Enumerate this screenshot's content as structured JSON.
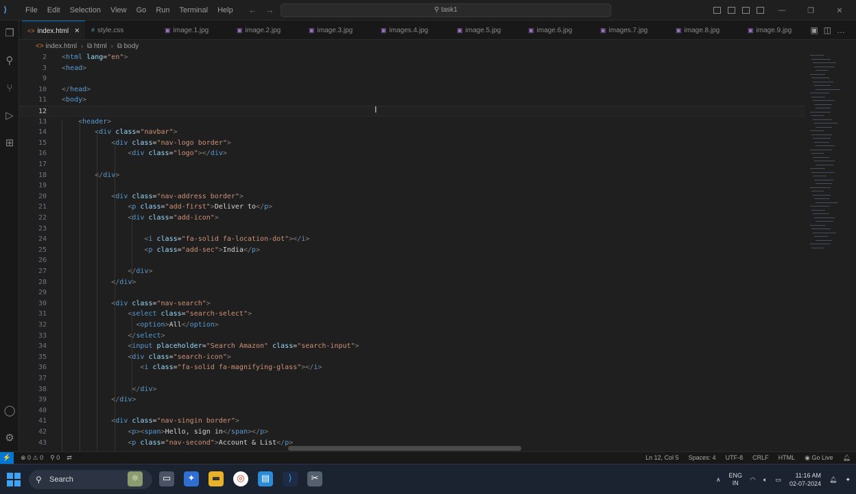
{
  "titlebar": {
    "menu": [
      "File",
      "Edit",
      "Selection",
      "View",
      "Go",
      "Run",
      "Terminal",
      "Help"
    ],
    "search": "task1"
  },
  "tabs": [
    {
      "label": "index.html",
      "icon": "html-file-icon",
      "active": true
    },
    {
      "label": "style.css",
      "icon": "css-file-icon",
      "active": false
    },
    {
      "label": "image.1.jpg",
      "icon": "image-file-icon",
      "active": false
    },
    {
      "label": "image.2.jpg",
      "icon": "image-file-icon",
      "active": false
    },
    {
      "label": "image.3.jpg",
      "icon": "image-file-icon",
      "active": false
    },
    {
      "label": "images.4.jpg",
      "icon": "image-file-icon",
      "active": false
    },
    {
      "label": "image.5.jpg",
      "icon": "image-file-icon",
      "active": false
    },
    {
      "label": "image.6.jpg",
      "icon": "image-file-icon",
      "active": false
    },
    {
      "label": "images.7.jpg",
      "icon": "image-file-icon",
      "active": false
    },
    {
      "label": "image.8.jpg",
      "icon": "image-file-icon",
      "active": false
    },
    {
      "label": "image.9.jpg",
      "icon": "image-file-icon",
      "active": false
    }
  ],
  "breadcrumb": [
    "index.html",
    "html",
    "body"
  ],
  "editor": {
    "current_line": 12,
    "lines": [
      {
        "n": "2",
        "code": "<html lang=\"en\">"
      },
      {
        "n": "3",
        "code": "<head>"
      },
      {
        "n": "9",
        "code": ""
      },
      {
        "n": "10",
        "code": "</head>"
      },
      {
        "n": "11",
        "code": "<body>"
      },
      {
        "n": "12",
        "code": ""
      },
      {
        "n": "13",
        "code": "    <header>"
      },
      {
        "n": "14",
        "code": "        <div class=\"navbar\">"
      },
      {
        "n": "15",
        "code": "            <div class=\"nav-logo border\">"
      },
      {
        "n": "16",
        "code": "                <div class=\"logo\"></div>"
      },
      {
        "n": "17",
        "code": ""
      },
      {
        "n": "18",
        "code": "        </div>"
      },
      {
        "n": "19",
        "code": ""
      },
      {
        "n": "20",
        "code": "            <div class=\"nav-address border\">"
      },
      {
        "n": "21",
        "code": "                <p class=\"add-first\">Deliver to</p>"
      },
      {
        "n": "22",
        "code": "                <div class=\"add-icon\">"
      },
      {
        "n": "23",
        "code": ""
      },
      {
        "n": "24",
        "code": "                    <i class=\"fa-solid fa-location-dot\"></i>"
      },
      {
        "n": "25",
        "code": "                    <p class=\"add-sec\">India</p>"
      },
      {
        "n": "26",
        "code": ""
      },
      {
        "n": "27",
        "code": "                </div>"
      },
      {
        "n": "28",
        "code": "            </div>"
      },
      {
        "n": "29",
        "code": ""
      },
      {
        "n": "30",
        "code": "            <div class=\"nav-search\">"
      },
      {
        "n": "31",
        "code": "                <select class=\"search-select\">"
      },
      {
        "n": "32",
        "code": "                  <option>All</option>"
      },
      {
        "n": "33",
        "code": "                </select>"
      },
      {
        "n": "34",
        "code": "                <input placeholder=\"Search Amazon\" class=\"search-input\">"
      },
      {
        "n": "35",
        "code": "                <div class=\"search-icon\">"
      },
      {
        "n": "36",
        "code": "                   <i class=\"fa-solid fa-magnifying-glass\"></i>"
      },
      {
        "n": "37",
        "code": ""
      },
      {
        "n": "38",
        "code": "                 </div>"
      },
      {
        "n": "39",
        "code": "            </div>"
      },
      {
        "n": "40",
        "code": ""
      },
      {
        "n": "41",
        "code": "            <div class=\"nav-singin border\">"
      },
      {
        "n": "42",
        "code": "                <p><span>Hello, sign in</span></p>"
      },
      {
        "n": "43",
        "code": "                <p class=\"nav-second\">Account & List</p>"
      }
    ]
  },
  "status": {
    "errors": "0",
    "warnings": "0",
    "ports": "0",
    "position": "Ln 12, Col 5",
    "spaces": "Spaces: 4",
    "encoding": "UTF-8",
    "eol": "CRLF",
    "language": "HTML",
    "golive": "Go Live"
  },
  "taskbar": {
    "search": "Search",
    "lang1": "ENG",
    "lang2": "IN",
    "time": "11:16 AM",
    "date": "02-07-2024"
  },
  "colors": {
    "accent": "#0078d4",
    "tag": "#569cd6",
    "attribute": "#9cdcfe",
    "string": "#ce9178"
  }
}
